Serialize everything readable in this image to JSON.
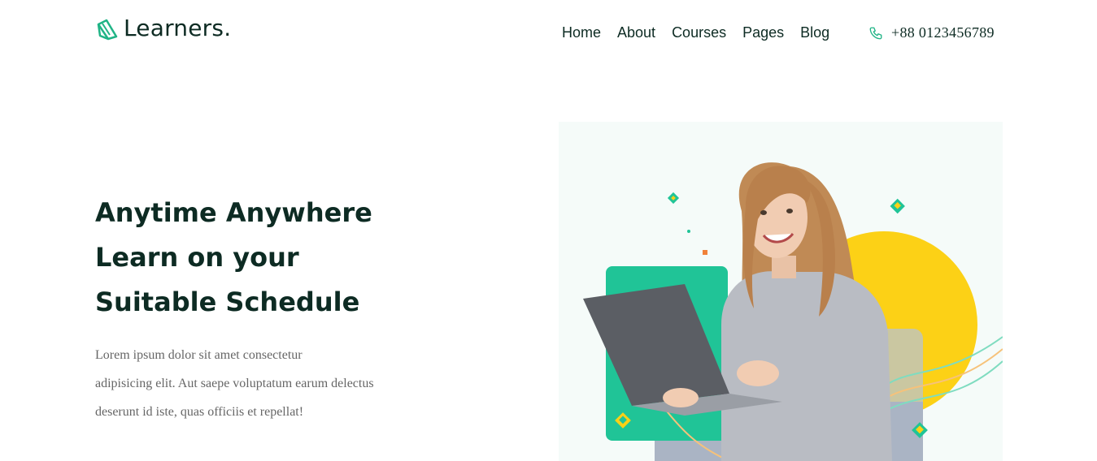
{
  "brand": {
    "name": "Learners",
    "dot": ".",
    "accent_color": "#20b486",
    "icon": "book-logo-icon"
  },
  "nav": {
    "items": [
      {
        "label": "Home"
      },
      {
        "label": "About"
      },
      {
        "label": "Courses"
      },
      {
        "label": "Pages"
      },
      {
        "label": "Blog"
      }
    ]
  },
  "contact": {
    "phone": "+88 0123456789",
    "icon": "phone-icon"
  },
  "hero": {
    "title_lines": [
      "Anytime Anywhere",
      "Learn on your",
      "Suitable Schedule"
    ],
    "description_lines": [
      "Lorem ipsum dolor sit amet consectetur",
      "adipisicing elit. Aut saepe voluptatum earum delectus",
      "deserunt id iste, quas officiis et repellat!"
    ],
    "colors": {
      "green": "#20c497",
      "yellow": "#fcd116",
      "slate": "#aab4c4"
    }
  }
}
